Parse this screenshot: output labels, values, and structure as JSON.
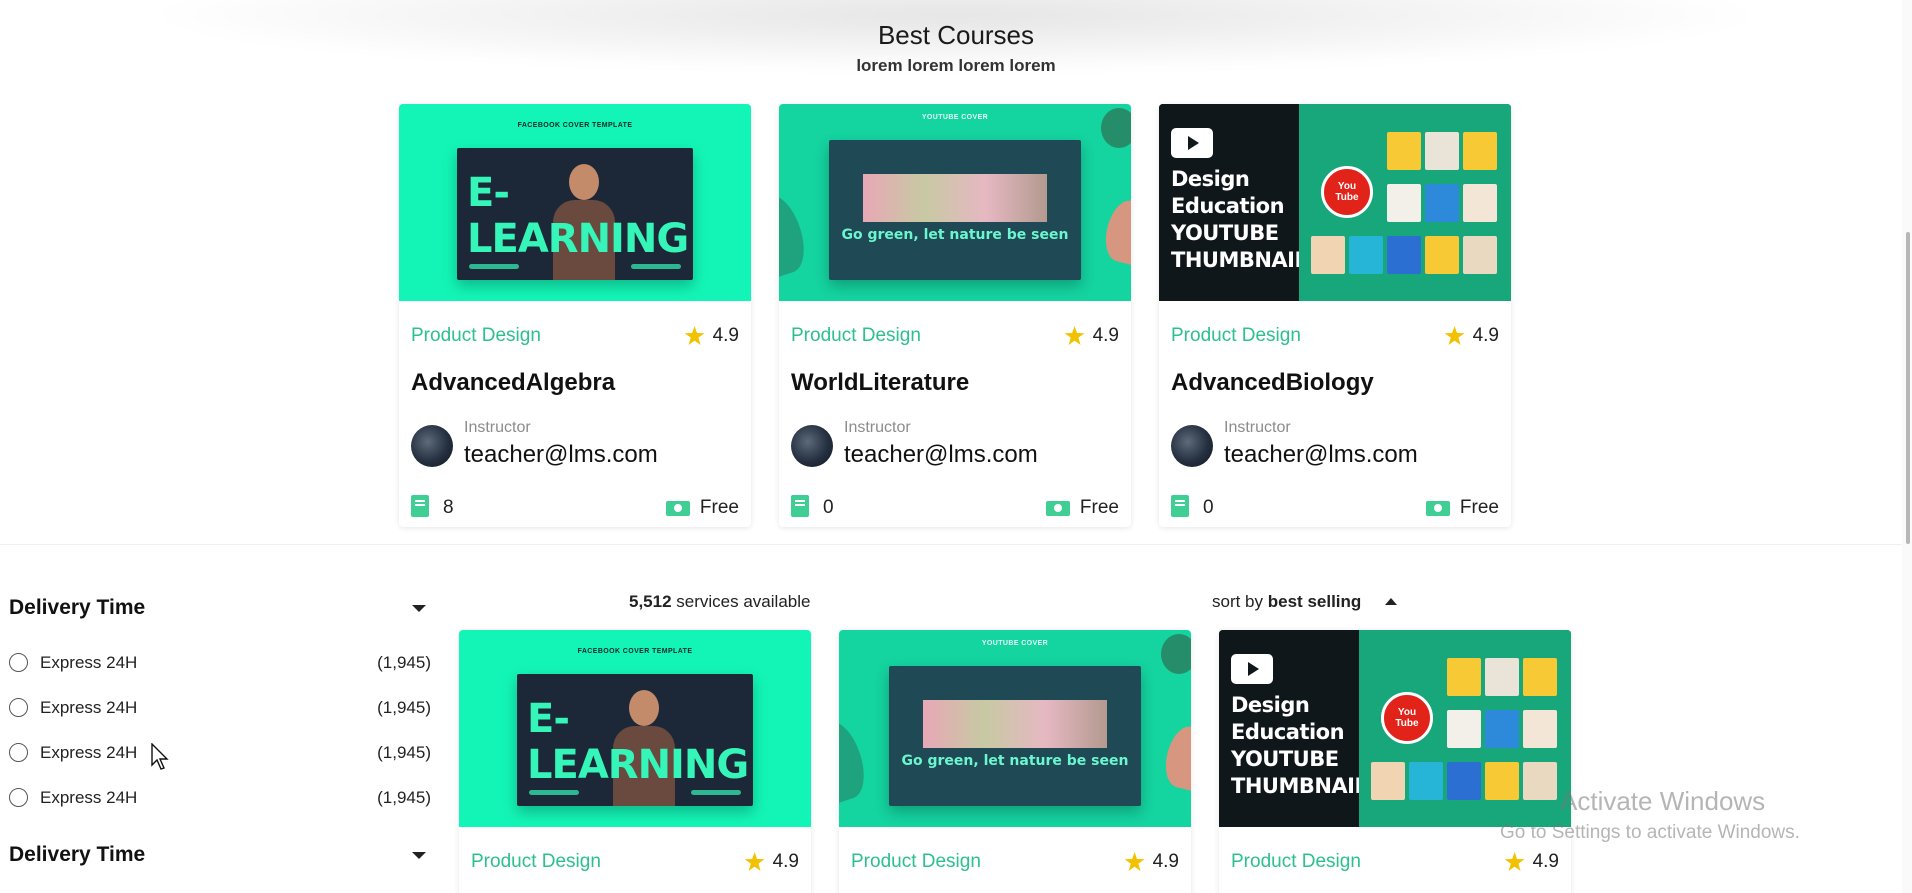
{
  "best_courses": {
    "title": "Best Courses",
    "subtitle": "lorem lorem lorem lorem",
    "cards": [
      {
        "thumbnail": "e-learning-cover",
        "thumb_label": "FACEBOOK COVER TEMPLATE",
        "thumb_headline": "E-LEARNING",
        "category": "Product Design",
        "rating": "4.9",
        "title": "AdvancedAlgebra",
        "instructor_label": "Instructor",
        "instructor_email": "teacher@lms.com",
        "lessons": "8",
        "price": "Free"
      },
      {
        "thumbnail": "youtube-cover-go-green",
        "thumb_label": "YOUTUBE COVER",
        "thumb_headline": "Go green, let nature be seen",
        "category": "Product Design",
        "rating": "4.9",
        "title": "WorldLiterature",
        "instructor_label": "Instructor",
        "instructor_email": "teacher@lms.com",
        "lessons": "0",
        "price": "Free"
      },
      {
        "thumbnail": "design-education-youtube-thumbnail",
        "thumb_headline": "Design Education YOUTUBE THUMBNAIL",
        "category": "Product Design",
        "rating": "4.9",
        "title": "AdvancedBiology",
        "instructor_label": "Instructor",
        "instructor_email": "teacher@lms.com",
        "lessons": "0",
        "price": "Free"
      }
    ]
  },
  "filters": {
    "groups": [
      {
        "heading": "Delivery Time",
        "options": [
          {
            "label": "Express 24H",
            "count": "(1,945)"
          },
          {
            "label": "Express 24H",
            "count": "(1,945)"
          },
          {
            "label": "Express 24H",
            "count": "(1,945)"
          },
          {
            "label": "Express 24H",
            "count": "(1,945)"
          }
        ]
      },
      {
        "heading": "Delivery Time",
        "options": []
      }
    ]
  },
  "results": {
    "count": "5,512",
    "count_suffix": "services available",
    "sort_prefix": "sort by",
    "sort_value": "best selling",
    "cards": [
      {
        "category": "Product Design",
        "rating": "4.9",
        "thumb_headline": "E-LEARNING",
        "thumb_label": "FACEBOOK COVER TEMPLATE"
      },
      {
        "category": "Product Design",
        "rating": "4.9",
        "thumb_headline": "Go green, let nature be seen",
        "thumb_label": "YOUTUBE COVER"
      },
      {
        "category": "Product Design",
        "rating": "4.9",
        "thumb_headline": "Design Education YOUTUBE THUMBNAIL"
      }
    ]
  },
  "watermark": {
    "title": "Activate Windows",
    "subtitle": "Go to Settings to activate Windows."
  },
  "colors": {
    "accent_green": "#2cc08e",
    "star_yellow": "#f2c200",
    "thumb_mint": "#13f5b6"
  }
}
